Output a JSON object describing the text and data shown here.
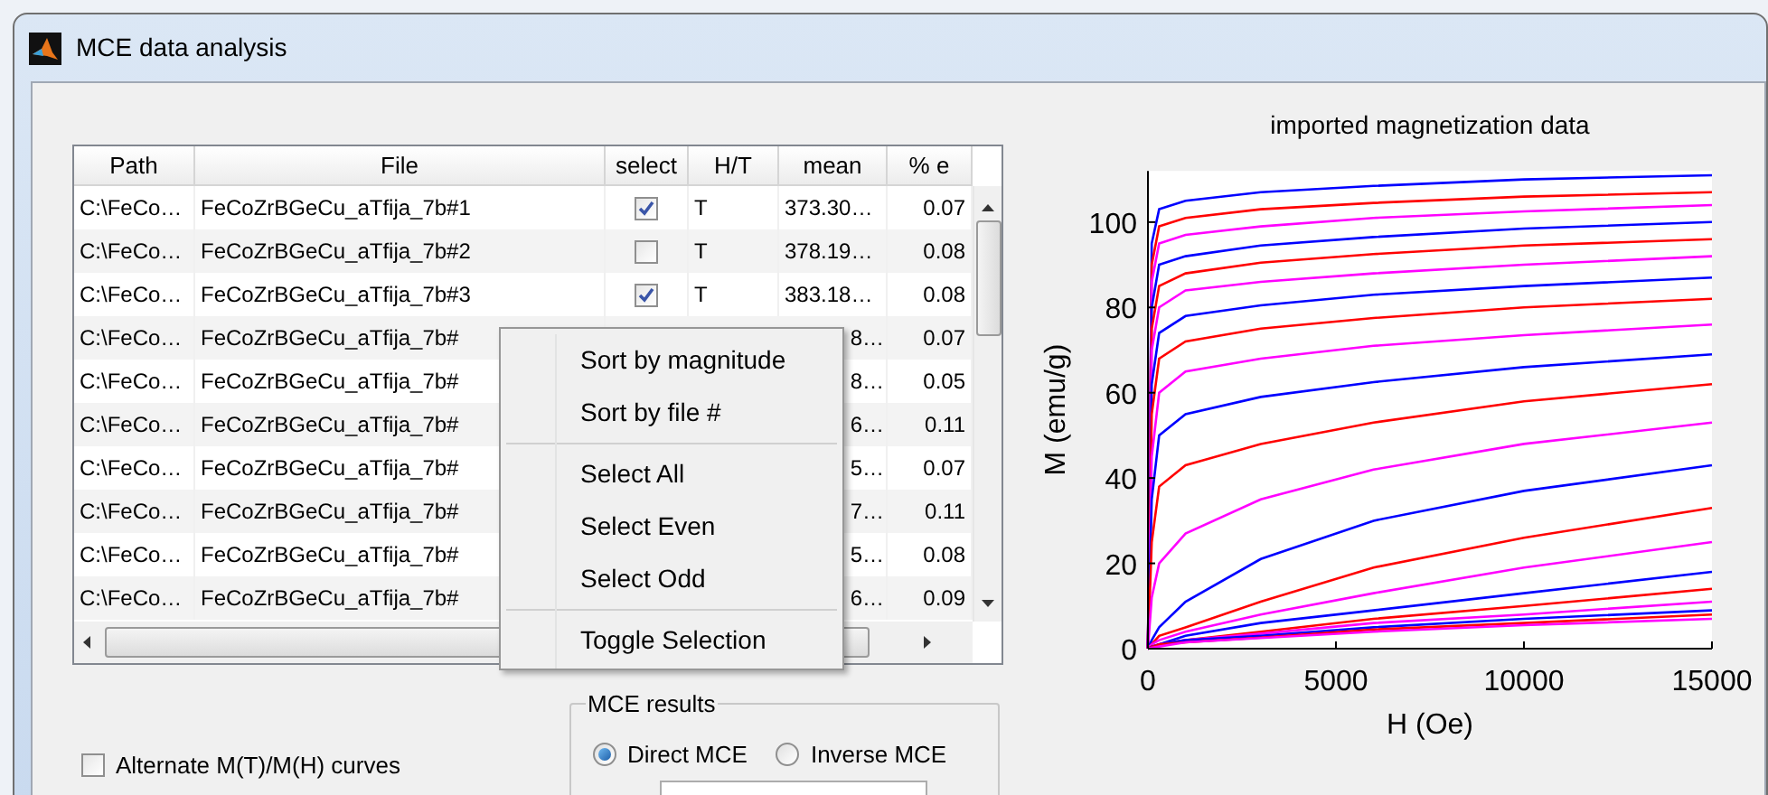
{
  "window": {
    "title": "MCE data analysis"
  },
  "table": {
    "columns": [
      "Path",
      "File",
      "select",
      "H/T",
      "mean",
      "% e"
    ],
    "rows": [
      {
        "kind": "full",
        "path": "C:\\FeCo…",
        "file": "FeCoZrBGeCu_aTfija_7b#1",
        "checked": true,
        "ht": "T",
        "mean": "373.30…",
        "pct": "0.07"
      },
      {
        "kind": "full",
        "path": "C:\\FeCo…",
        "file": "FeCoZrBGeCu_aTfija_7b#2",
        "checked": false,
        "ht": "T",
        "mean": "378.19…",
        "pct": "0.08"
      },
      {
        "kind": "full",
        "path": "C:\\FeCo…",
        "file": "FeCoZrBGeCu_aTfija_7b#3",
        "checked": true,
        "ht": "T",
        "mean": "383.18…",
        "pct": "0.08"
      },
      {
        "kind": "covered",
        "path": "C:\\FeCo…",
        "file": "FeCoZrBGeCu_aTfija_7b#",
        "mean": "8…",
        "pct": "0.07"
      },
      {
        "kind": "covered",
        "path": "C:\\FeCo…",
        "file": "FeCoZrBGeCu_aTfija_7b#",
        "mean": "8…",
        "pct": "0.05"
      },
      {
        "kind": "covered",
        "path": "C:\\FeCo…",
        "file": "FeCoZrBGeCu_aTfija_7b#",
        "mean": "6…",
        "pct": "0.11"
      },
      {
        "kind": "covered",
        "path": "C:\\FeCo…",
        "file": "FeCoZrBGeCu_aTfija_7b#",
        "mean": "5…",
        "pct": "0.07"
      },
      {
        "kind": "covered",
        "path": "C:\\FeCo…",
        "file": "FeCoZrBGeCu_aTfija_7b#",
        "mean": "7…",
        "pct": "0.11"
      },
      {
        "kind": "covered",
        "path": "C:\\FeCo…",
        "file": "FeCoZrBGeCu_aTfija_7b#",
        "mean": "5…",
        "pct": "0.08"
      },
      {
        "kind": "covered",
        "path": "C:\\FeCo…",
        "file": "FeCoZrBGeCu_aTfija_7b#",
        "mean": "6…",
        "pct": "0.09"
      }
    ]
  },
  "context_menu": {
    "groups": [
      [
        "Sort by magnitude",
        "Sort by file #"
      ],
      [
        "Select All",
        "Select Even",
        "Select Odd"
      ],
      [
        "Toggle Selection"
      ]
    ]
  },
  "alternate_curves": {
    "label": "Alternate M(T)/M(H) curves",
    "checked": false
  },
  "mce_results": {
    "title": "MCE results",
    "options": [
      {
        "label": "Direct MCE",
        "selected": true
      },
      {
        "label": "Inverse MCE",
        "selected": false
      }
    ]
  },
  "plot": {
    "chart_data": {
      "type": "line",
      "title": "imported magnetization data",
      "xlabel": "H (Oe)",
      "ylabel": "M (emu/g)",
      "x": [
        0,
        100,
        300,
        1000,
        3000,
        6000,
        10000,
        15000
      ],
      "xlim": [
        0,
        15000
      ],
      "ylim": [
        0,
        112
      ],
      "xticks": [
        0,
        5000,
        10000,
        15000
      ],
      "yticks": [
        0,
        20,
        40,
        60,
        80,
        100
      ],
      "series": [
        {
          "color": "#0000ff",
          "values": [
            0,
            95,
            103,
            105,
            107,
            108.5,
            110,
            111
          ]
        },
        {
          "color": "#ff0000",
          "values": [
            0,
            90,
            99,
            101,
            103,
            104.5,
            106,
            107
          ]
        },
        {
          "color": "#ff00ff",
          "values": [
            0,
            86,
            95,
            97,
            99,
            101,
            102.5,
            104
          ]
        },
        {
          "color": "#0000ff",
          "values": [
            0,
            80,
            90,
            92,
            94.5,
            96.5,
            98.5,
            100
          ]
        },
        {
          "color": "#ff0000",
          "values": [
            0,
            75,
            85,
            88,
            90.5,
            92.5,
            94.5,
            96
          ]
        },
        {
          "color": "#ff00ff",
          "values": [
            0,
            70,
            80,
            84,
            86,
            88,
            90,
            92
          ]
        },
        {
          "color": "#0000ff",
          "values": [
            0,
            62,
            74,
            78,
            80.5,
            83,
            85,
            87
          ]
        },
        {
          "color": "#ff0000",
          "values": [
            0,
            55,
            68,
            72,
            75,
            77.5,
            80,
            82
          ]
        },
        {
          "color": "#ff00ff",
          "values": [
            0,
            45,
            60,
            65,
            68,
            71,
            73.5,
            76
          ]
        },
        {
          "color": "#0000ff",
          "values": [
            0,
            35,
            50,
            55,
            59,
            62.5,
            66,
            69
          ]
        },
        {
          "color": "#ff0000",
          "values": [
            0,
            25,
            38,
            43,
            48,
            53,
            58,
            62
          ]
        },
        {
          "color": "#ff00ff",
          "values": [
            0,
            12,
            20,
            27,
            35,
            42,
            48,
            53
          ]
        },
        {
          "color": "#0000ff",
          "values": [
            0,
            2,
            5,
            11,
            21,
            30,
            37,
            43
          ]
        },
        {
          "color": "#ff0000",
          "values": [
            0,
            1,
            3,
            5,
            11,
            19,
            26,
            33
          ]
        },
        {
          "color": "#ff00ff",
          "values": [
            0,
            1,
            2,
            4,
            8,
            13,
            19,
            25
          ]
        },
        {
          "color": "#0000ff",
          "values": [
            0,
            0.5,
            1,
            3,
            6,
            9,
            13,
            18
          ]
        },
        {
          "color": "#ff0000",
          "values": [
            0,
            0.5,
            1,
            2,
            4,
            7,
            10,
            14
          ]
        },
        {
          "color": "#ff00ff",
          "values": [
            0,
            0.3,
            1,
            2,
            3.5,
            6,
            8,
            11
          ]
        },
        {
          "color": "#0000ff",
          "values": [
            0,
            0.3,
            1,
            2,
            3,
            5,
            7,
            9
          ]
        },
        {
          "color": "#ff0000",
          "values": [
            0,
            0.3,
            1,
            1.5,
            2.6,
            4.5,
            6,
            8
          ]
        },
        {
          "color": "#ff00ff",
          "values": [
            0,
            0.2,
            0.5,
            1.5,
            2.5,
            4,
            5.5,
            7
          ]
        }
      ]
    }
  }
}
